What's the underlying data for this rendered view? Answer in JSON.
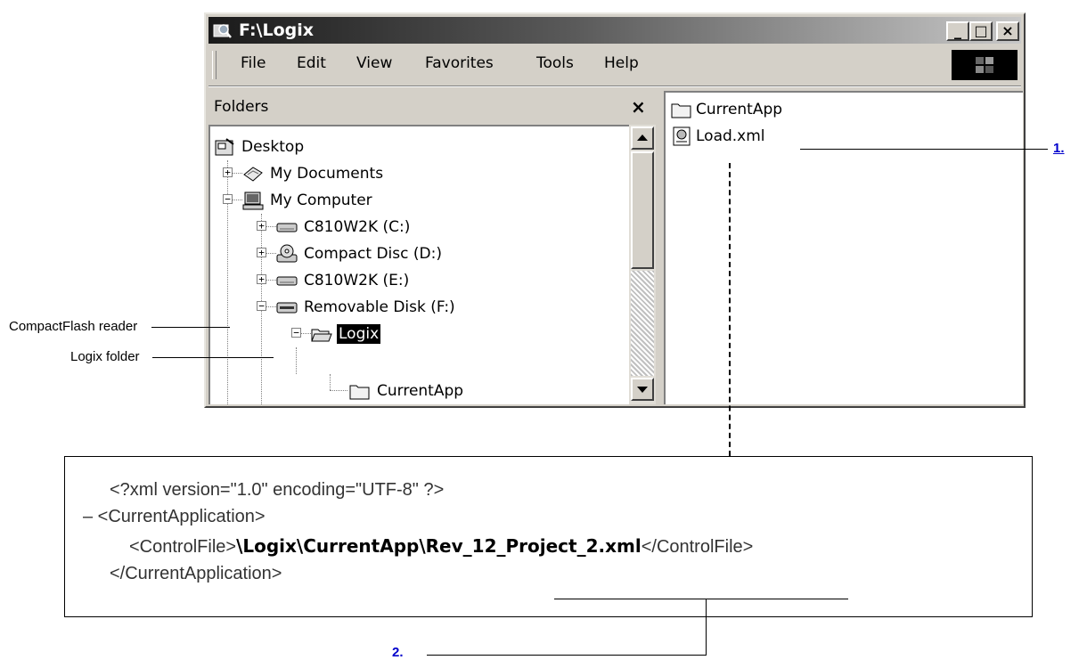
{
  "window": {
    "title": "F:\\Logix",
    "minimize": "_",
    "maximize": "□",
    "close": "×"
  },
  "menu": [
    "File",
    "Edit",
    "View",
    "Favorites",
    "Tools",
    "Help"
  ],
  "folders_pane": {
    "title": "Folders",
    "close": "×",
    "tree": [
      {
        "label": "Desktop",
        "icon": "desktop-icon"
      },
      {
        "label": "My Documents",
        "icon": "my-documents-icon",
        "toggle": "+"
      },
      {
        "label": "My Computer",
        "icon": "my-computer-icon",
        "toggle": "−"
      },
      {
        "label": "C810W2K (C:)",
        "icon": "drive-icon",
        "toggle": "+"
      },
      {
        "label": "Compact Disc (D:)",
        "icon": "cd-drive-icon",
        "toggle": "+"
      },
      {
        "label": "C810W2K (E:)",
        "icon": "drive-icon",
        "toggle": "+"
      },
      {
        "label": "Removable Disk (F:)",
        "icon": "removable-disk-icon",
        "toggle": "−"
      },
      {
        "label": "Logix",
        "icon": "folder-open-icon",
        "toggle": "−",
        "selected": true
      },
      {
        "label": "CurrentApp",
        "icon": "folder-icon"
      }
    ]
  },
  "files_pane": {
    "items": [
      {
        "label": "CurrentApp",
        "icon": "folder-icon"
      },
      {
        "label": "Load.xml",
        "icon": "xml-file-icon"
      }
    ]
  },
  "annotations": {
    "callout_1": "1.",
    "callout_2": "2.",
    "compactflash_label": "CompactFlash reader",
    "logix_label": "Logix folder"
  },
  "xml": {
    "line1": "<?xml version=\"1.0\" encoding=\"UTF-8\" ?>",
    "line2": "– <CurrentApplication>",
    "line3_open": "<ControlFile>",
    "line3_path": "\\Logix\\CurrentApp\\Rev_12_Project_2.xml",
    "line3_close": "</ControlFile>",
    "line4": "</CurrentApplication>"
  },
  "colors": {
    "callout": "#0000cc",
    "selection": "#000000"
  }
}
